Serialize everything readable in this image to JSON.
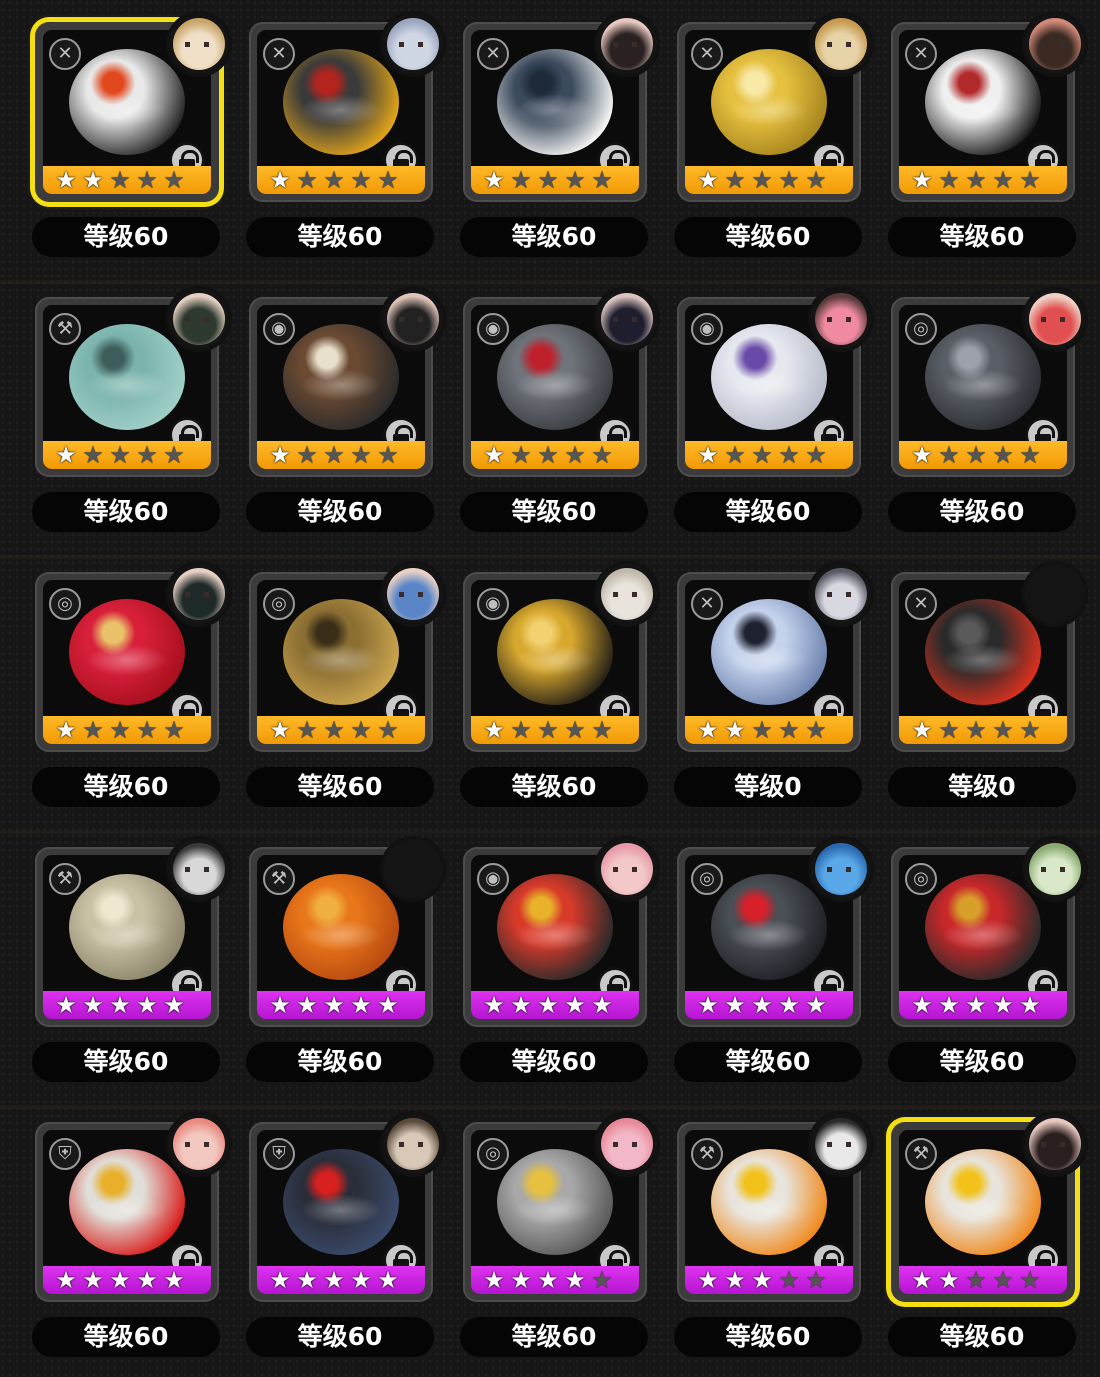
{
  "ui_colors": {
    "rarity_a": "#f5a511",
    "rarity_s": "#c71fe0",
    "selected_border": "#f3df12",
    "background": "#161616"
  },
  "items": [
    {
      "level_label": "等级60",
      "stars": 2,
      "rarity": "A",
      "selected": true,
      "locked": true,
      "type_icon": "slash-type-icon",
      "art_colors": [
        "#e8e8e8",
        "#2a2a2a",
        "#e2481e"
      ],
      "avatar_colors": [
        "#f1e0c8",
        "#c9a56a"
      ]
    },
    {
      "level_label": "等级60",
      "stars": 1,
      "rarity": "A",
      "selected": false,
      "locked": true,
      "type_icon": "slash-type-icon",
      "art_colors": [
        "#3a3a3a",
        "#e0a41a",
        "#b3241e"
      ],
      "avatar_colors": [
        "#cfd6e4",
        "#9aa6c0"
      ]
    },
    {
      "level_label": "等级60",
      "stars": 1,
      "rarity": "A",
      "selected": false,
      "locked": true,
      "type_icon": "slash-type-icon",
      "art_colors": [
        "#3b4a5c",
        "#f4f4f4",
        "#1e2a38"
      ],
      "avatar_colors": [
        "#2a2222",
        "#e8c8c0"
      ]
    },
    {
      "level_label": "等级60",
      "stars": 1,
      "rarity": "A",
      "selected": false,
      "locked": true,
      "type_icon": "slash-type-icon",
      "art_colors": [
        "#e6c140",
        "#a8861e",
        "#f8e9a8"
      ],
      "avatar_colors": [
        "#e6d3a8",
        "#c79a4f"
      ]
    },
    {
      "level_label": "等级60",
      "stars": 1,
      "rarity": "A",
      "selected": false,
      "locked": true,
      "type_icon": "slash-type-icon",
      "art_colors": [
        "#efefef",
        "#1e1e1e",
        "#b22a2a"
      ],
      "avatar_colors": [
        "#3a2a22",
        "#d28a7a"
      ]
    },
    {
      "level_label": "等级60",
      "stars": 1,
      "rarity": "A",
      "selected": false,
      "locked": true,
      "type_icon": "strike-type-icon",
      "art_colors": [
        "#7bb3ad",
        "#9fd0c8",
        "#3e5e5a"
      ],
      "avatar_colors": [
        "#2e3a30",
        "#e4d0c0"
      ]
    },
    {
      "level_label": "等级60",
      "stars": 1,
      "rarity": "A",
      "selected": false,
      "locked": true,
      "type_icon": "pierce-type-icon",
      "art_colors": [
        "#6b4a32",
        "#2b2b2b",
        "#e8e0cc"
      ],
      "avatar_colors": [
        "#222222",
        "#e0c4b8"
      ]
    },
    {
      "level_label": "等级60",
      "stars": 1,
      "rarity": "A",
      "selected": false,
      "locked": true,
      "type_icon": "pierce-type-icon",
      "art_colors": [
        "#6f737a",
        "#3a3d42",
        "#c0202c"
      ],
      "avatar_colors": [
        "#1e1e2e",
        "#dcc4c0"
      ]
    },
    {
      "level_label": "等级60",
      "stars": 1,
      "rarity": "A",
      "selected": false,
      "locked": true,
      "type_icon": "pierce-type-icon",
      "art_colors": [
        "#e6e8f0",
        "#b9bdcc",
        "#6a4aa8"
      ],
      "avatar_colors": [
        "#f08aa0",
        "#5a3a3a"
      ]
    },
    {
      "level_label": "等级60",
      "stars": 1,
      "rarity": "A",
      "selected": false,
      "locked": true,
      "type_icon": "orbit-type-icon",
      "art_colors": [
        "#5a5e66",
        "#2c2e33",
        "#9ca1aa"
      ],
      "avatar_colors": [
        "#e05050",
        "#f0d0c4"
      ]
    },
    {
      "level_label": "等级60",
      "stars": 1,
      "rarity": "A",
      "selected": false,
      "locked": true,
      "type_icon": "orbit-type-icon",
      "art_colors": [
        "#d8203a",
        "#a8101e",
        "#e9c26a"
      ],
      "avatar_colors": [
        "#1e2a28",
        "#e8d0c4"
      ]
    },
    {
      "level_label": "等级60",
      "stars": 1,
      "rarity": "A",
      "selected": false,
      "locked": true,
      "type_icon": "orbit-type-icon",
      "art_colors": [
        "#8a6e32",
        "#caa44e",
        "#3a2e18"
      ],
      "avatar_colors": [
        "#5a86c8",
        "#e8d0c4"
      ]
    },
    {
      "level_label": "等级60",
      "stars": 1,
      "rarity": "A",
      "selected": false,
      "locked": true,
      "type_icon": "pierce-type-icon",
      "art_colors": [
        "#d8a82e",
        "#2a2418",
        "#f2d270"
      ],
      "avatar_colors": [
        "#e8e4dc",
        "#c0b8a8"
      ]
    },
    {
      "level_label": "等级0",
      "stars": 2,
      "rarity": "A",
      "selected": false,
      "locked": true,
      "type_icon": "slash-type-icon",
      "art_colors": [
        "#c4d2ec",
        "#6f84b0",
        "#1e2230"
      ],
      "avatar_colors": [
        "#d8d8e0",
        "#5a5a66"
      ]
    },
    {
      "level_label": "等级0",
      "stars": 1,
      "rarity": "A",
      "selected": false,
      "locked": true,
      "type_icon": "slash-type-icon",
      "art_colors": [
        "#2a2a2a",
        "#d8301e",
        "#5a5a5a"
      ],
      "avatar_colors": null
    },
    {
      "level_label": "等级60",
      "stars": 5,
      "rarity": "S",
      "selected": false,
      "locked": true,
      "type_icon": "strike-type-icon",
      "art_colors": [
        "#c9c1a4",
        "#8d866c",
        "#efe8d0"
      ],
      "avatar_colors": [
        "#d8d8d8",
        "#3a3a3a"
      ]
    },
    {
      "level_label": "等级60",
      "stars": 5,
      "rarity": "S",
      "selected": false,
      "locked": true,
      "type_icon": "strike-type-icon",
      "art_colors": [
        "#e8761a",
        "#b84a10",
        "#f0b040"
      ],
      "avatar_colors": null
    },
    {
      "level_label": "等级60",
      "stars": 5,
      "rarity": "S",
      "selected": false,
      "locked": true,
      "type_icon": "pierce-type-icon",
      "art_colors": [
        "#d83a2a",
        "#2a2a2a",
        "#e8b22a"
      ],
      "avatar_colors": [
        "#f2c8c8",
        "#e89aa8"
      ]
    },
    {
      "level_label": "等级60",
      "stars": 5,
      "rarity": "S",
      "selected": false,
      "locked": true,
      "type_icon": "orbit-type-icon",
      "art_colors": [
        "#4a4e55",
        "#1e2024",
        "#d8202a"
      ],
      "avatar_colors": [
        "#5aa8e8",
        "#2a6ab0"
      ]
    },
    {
      "level_label": "等级60",
      "stars": 5,
      "rarity": "S",
      "selected": false,
      "locked": true,
      "type_icon": "orbit-type-icon",
      "art_colors": [
        "#c8282a",
        "#2a2a2a",
        "#d8a02a"
      ],
      "avatar_colors": [
        "#d8e8c8",
        "#8aaa70"
      ]
    },
    {
      "level_label": "等级60",
      "stars": 5,
      "rarity": "S",
      "selected": false,
      "locked": true,
      "type_icon": "shield-type-icon",
      "art_colors": [
        "#e0ded8",
        "#d8201e",
        "#e8b02a"
      ],
      "avatar_colors": [
        "#f2c8c0",
        "#e88a80"
      ]
    },
    {
      "level_label": "等级60",
      "stars": 5,
      "rarity": "S",
      "selected": false,
      "locked": true,
      "type_icon": "shield-type-icon",
      "art_colors": [
        "#2a2e3a",
        "#3a4a6a",
        "#d8201e"
      ],
      "avatar_colors": [
        "#d8c8b8",
        "#5a4a3a"
      ]
    },
    {
      "level_label": "等级60",
      "stars": 4,
      "rarity": "S",
      "selected": false,
      "locked": true,
      "type_icon": "orbit-type-icon",
      "art_colors": [
        "#a8a8a8",
        "#5a5a5a",
        "#e8c040"
      ],
      "avatar_colors": [
        "#f2b8c8",
        "#e88898"
      ]
    },
    {
      "level_label": "等级60",
      "stars": 3,
      "rarity": "S",
      "selected": false,
      "locked": true,
      "type_icon": "strike-type-icon",
      "art_colors": [
        "#e8e4dc",
        "#f08a1e",
        "#f2c21a"
      ],
      "avatar_colors": [
        "#e8e8e8",
        "#2a2a2a"
      ]
    },
    {
      "level_label": "等级60",
      "stars": 2,
      "rarity": "S",
      "selected": true,
      "locked": true,
      "type_icon": "strike-type-icon",
      "art_colors": [
        "#e8e4dc",
        "#f08a1e",
        "#f2c21a"
      ],
      "avatar_colors": [
        "#2a1e1e",
        "#e8c8c0"
      ]
    }
  ]
}
